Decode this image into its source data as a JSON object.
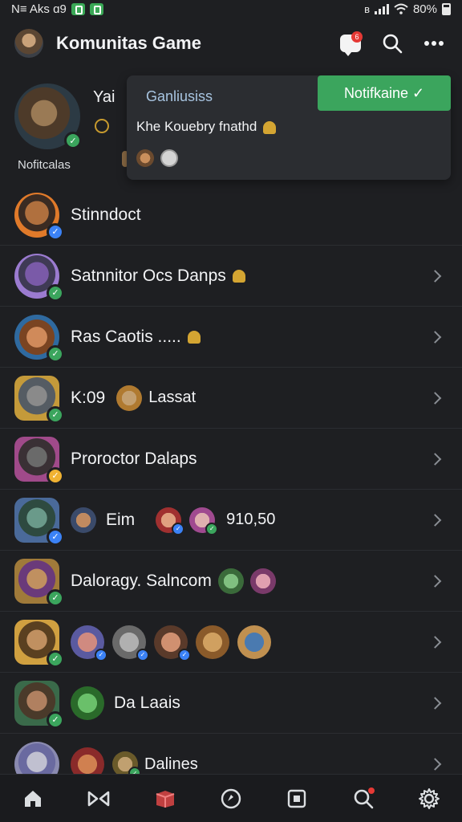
{
  "status_bar": {
    "left_text": "N≡ Aks ɑ9",
    "battery": "80%"
  },
  "header": {
    "title": "Komunitas Game",
    "chat_badge": "6"
  },
  "profile": {
    "name": "Yai",
    "label": "Nofitcalas"
  },
  "notification": {
    "subtitle": "Ganliusiss",
    "button_label": "Notifkaine ✓",
    "message": "Khe Kouebry fnathd"
  },
  "rows": [
    {
      "name": "Stinndoct"
    },
    {
      "name": "Satnnitor Ocs Danps"
    },
    {
      "name": "Ras Caotis  ....."
    },
    {
      "name": "K:09",
      "extra": "Lassat"
    },
    {
      "name": "Proroctor Dalaps"
    },
    {
      "name": "Eim",
      "extra": "910,50"
    },
    {
      "name": "Daloragy. Salncom"
    },
    {
      "name": ""
    },
    {
      "name": "Da Laais"
    },
    {
      "extra": "Dalines"
    }
  ],
  "colors": {
    "accent_green": "#3ba55d",
    "badge_red": "#e53935",
    "background": "#1e1f22"
  }
}
